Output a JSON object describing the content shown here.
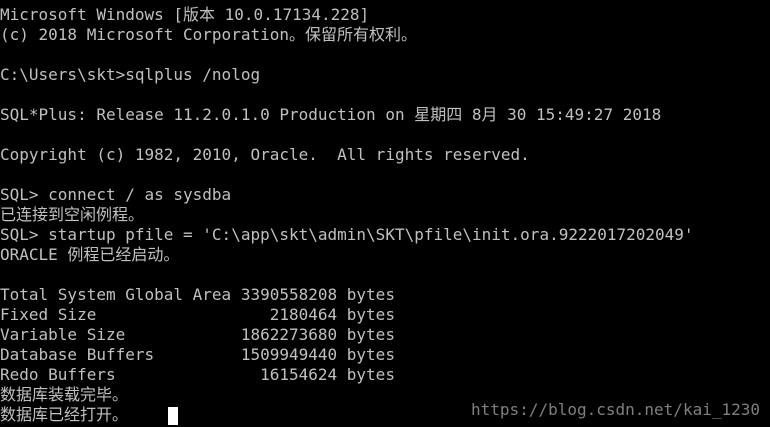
{
  "console": {
    "lines": [
      "Microsoft Windows [版本 10.0.17134.228]",
      "(c) 2018 Microsoft Corporation。保留所有权利。",
      "",
      "C:\\Users\\skt>sqlplus /nolog",
      "",
      "SQL*Plus: Release 11.2.0.1.0 Production on 星期四 8月 30 15:49:27 2018",
      "",
      "Copyright (c) 1982, 2010, Oracle.  All rights reserved.",
      "",
      "SQL> connect / as sysdba",
      "已连接到空闲例程。",
      "SQL> startup pfile = 'C:\\app\\skt\\admin\\SKT\\pfile\\init.ora.9222017202049'",
      "ORACLE 例程已经启动。",
      "",
      "Total System Global Area 3390558208 bytes",
      "Fixed Size                  2180464 bytes",
      "Variable Size            1862273680 bytes",
      "Database Buffers         1509949440 bytes",
      "Redo Buffers               16154624 bytes",
      "数据库装载完毕。",
      "数据库已经打开。"
    ]
  },
  "watermark": "https://blog.csdn.net/kai_1230",
  "colors": {
    "background": "#000000",
    "text": "#c0c0c0",
    "cursor": "#ffffff",
    "watermark": "#7f7f7f"
  }
}
